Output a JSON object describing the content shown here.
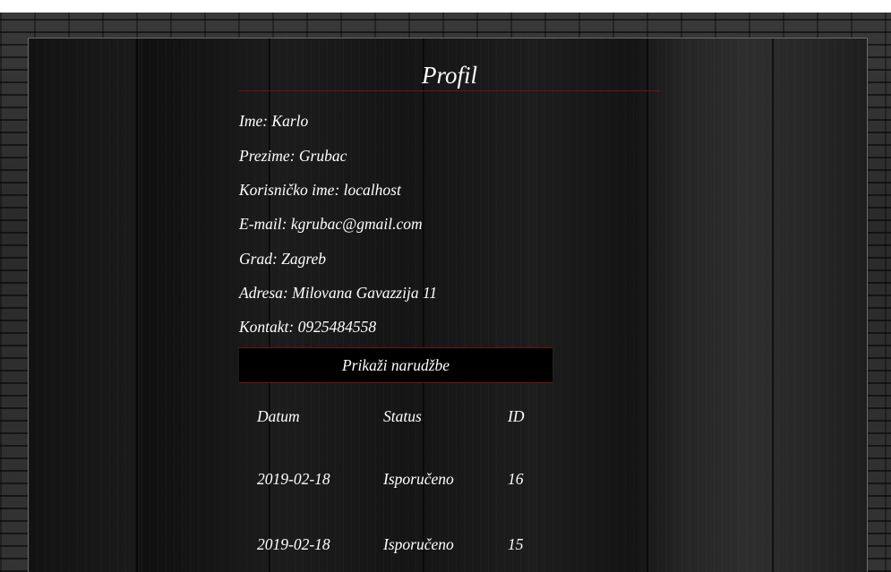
{
  "profile": {
    "title": "Profil",
    "fields": [
      {
        "text": "Ime: Karlo"
      },
      {
        "text": "Prezime: Grubac"
      },
      {
        "text": "Korisničko ime: localhost"
      },
      {
        "text": "E-mail: kgrubac@gmail.com"
      },
      {
        "text": "Grad: Zagreb"
      },
      {
        "text": "Adresa: Milovana Gavazzija 11"
      },
      {
        "text": "Kontakt: 0925484558"
      }
    ],
    "orders_button": "Prikaži narudžbe"
  },
  "orders": {
    "headers": [
      "Datum",
      "Status",
      "ID"
    ],
    "rows": [
      [
        "2019-02-18",
        "Isporučeno",
        "16"
      ],
      [
        "2019-02-18",
        "Isporučeno",
        "15"
      ]
    ]
  }
}
